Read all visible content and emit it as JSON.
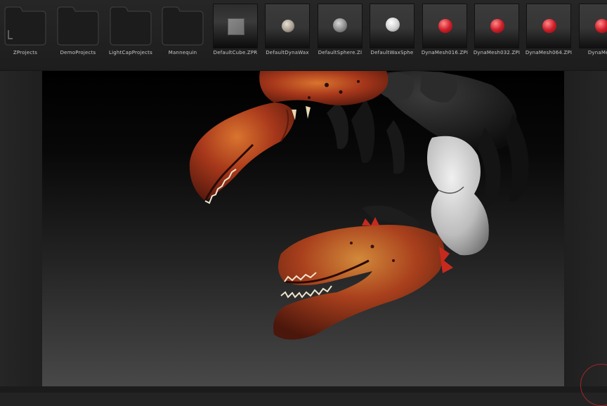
{
  "lightbox": {
    "items": [
      {
        "label": "ZProjects",
        "kind": "folder",
        "icon": "folder-icon"
      },
      {
        "label": "DemoProjects",
        "kind": "folder",
        "icon": "folder-icon"
      },
      {
        "label": "LightCapProjects",
        "kind": "folder",
        "icon": "folder-icon"
      },
      {
        "label": "Mannequin",
        "kind": "folder",
        "icon": "folder-icon"
      },
      {
        "label": "DefaultCube.ZPR",
        "kind": "file",
        "icon": "cube-thumbnail"
      },
      {
        "label": "DefaultDynaWax",
        "kind": "file",
        "icon": "sphere-thumbnail"
      },
      {
        "label": "DefaultSphere.ZI",
        "kind": "file",
        "icon": "sphere-thumbnail"
      },
      {
        "label": "DefaultWaxSphe",
        "kind": "file",
        "icon": "sphere-thumbnail"
      },
      {
        "label": "DynaMesh016.ZPI",
        "kind": "file",
        "icon": "red-sphere-thumbnail"
      },
      {
        "label": "DynaMesh032.ZPI",
        "kind": "file",
        "icon": "red-sphere-thumbnail"
      },
      {
        "label": "DynaMesh064.ZPI",
        "kind": "file",
        "icon": "red-sphere-thumbnail"
      },
      {
        "label": "DynaMesh",
        "kind": "file",
        "icon": "red-sphere-thumbnail"
      }
    ]
  },
  "colors": {
    "accent": "#d1202a",
    "shell_orange": "#b8401c",
    "shell_dark": "#1e1e1e",
    "shell_grey": "#cfcfcf"
  },
  "viewport": {
    "subject": "lobster-model"
  }
}
